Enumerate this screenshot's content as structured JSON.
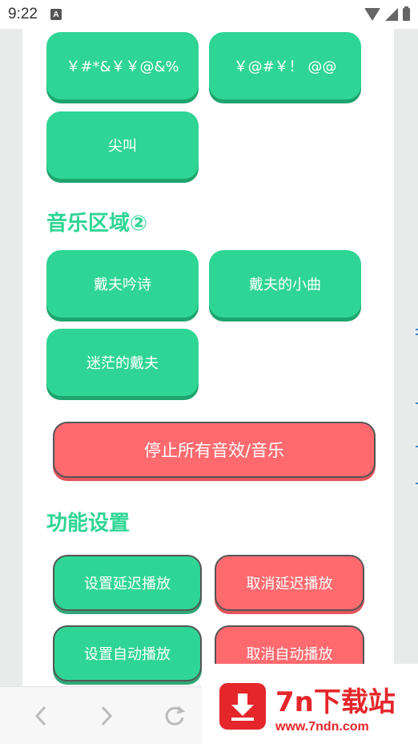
{
  "status": {
    "time": "9:22",
    "notification_letter": "A"
  },
  "sound_buttons": {
    "b1": "￥#*&￥￥@&%",
    "b2": "￥@#￥！ @@",
    "b3": "尖叫"
  },
  "music_section": {
    "title": "音乐区域②",
    "items": [
      "戴夫吟诗",
      "戴夫的小曲",
      "迷茫的戴夫"
    ]
  },
  "stop_all_label": "停止所有音效/音乐",
  "settings_section": {
    "title": "功能设置",
    "set_delay": "设置延迟播放",
    "cancel_delay": "取消延迟播放",
    "set_auto": "设置自动播放",
    "cancel_auto": "取消自动播放"
  },
  "browser_nav": {
    "back_icon": "chevron-left-icon",
    "forward_icon": "chevron-right-icon",
    "refresh_icon": "refresh-icon"
  },
  "watermark": {
    "title": "7n下载站",
    "url": "www.7ndn.com"
  },
  "colors": {
    "green": "#2fd594",
    "red": "#ff6a6f",
    "watermark_red": "#e5262a"
  }
}
